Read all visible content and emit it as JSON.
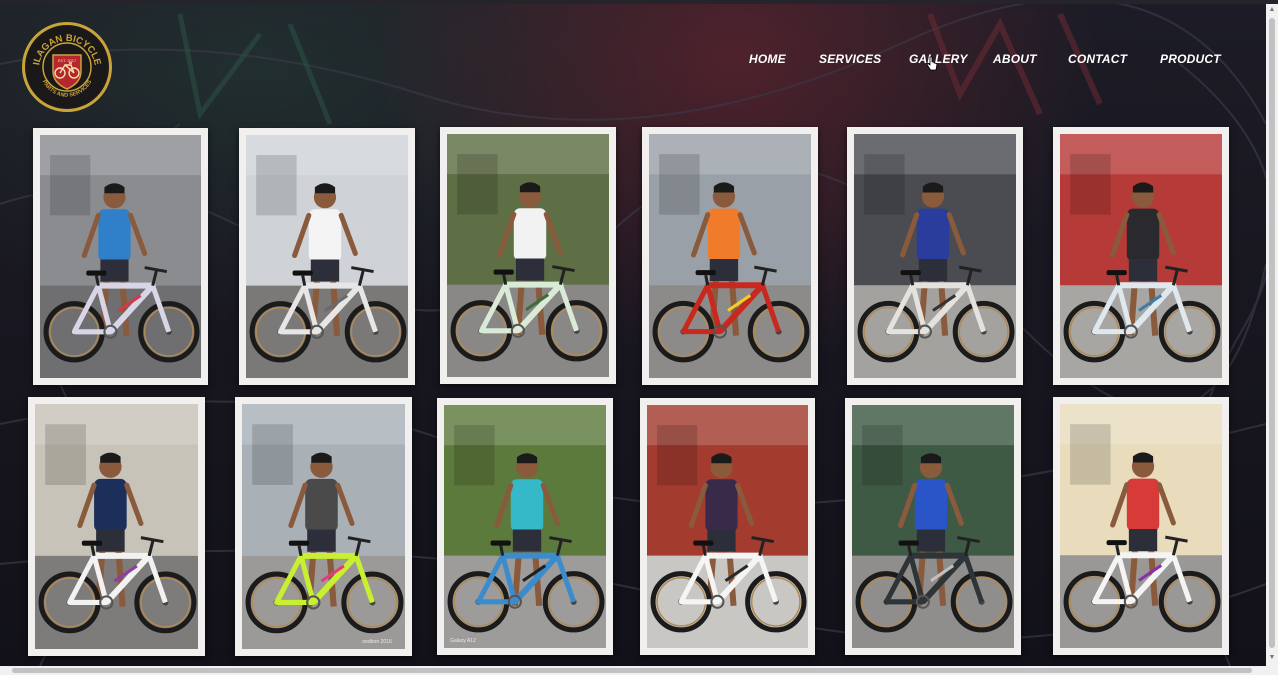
{
  "brand": {
    "name_top": "ILAGAN BICYCLE",
    "est": "EST. 2017",
    "tagline": "PARTS AND SERVICES",
    "colors": {
      "gold": "#c9a43a",
      "red": "#b5262f"
    }
  },
  "nav": {
    "items": [
      {
        "label": "HOME"
      },
      {
        "label": "SERVICES"
      },
      {
        "label": "GALLERY"
      },
      {
        "label": "ABOUT"
      },
      {
        "label": "CONTACT"
      },
      {
        "label": "PRODUCT"
      }
    ]
  },
  "gallery": {
    "photos": [
      {
        "shirt": "#2f7fc9",
        "frame": "#d8d6e6",
        "accent": "#d23a4a",
        "wall": "#8a8c90",
        "ground": "#6f6f72"
      },
      {
        "shirt": "#f4f4f4",
        "frame": "#e6e6e6",
        "accent": "#6a6a6a",
        "wall": "#cfd3d8",
        "ground": "#7a7978"
      },
      {
        "shirt": "#f2f2f2",
        "frame": "#d9ead7",
        "accent": "#3c6e3a",
        "wall": "#5e6e45",
        "ground": "#8a8886"
      },
      {
        "shirt": "#f07b2a",
        "frame": "#c8281e",
        "accent": "#f0d020",
        "wall": "#9aa0a8",
        "ground": "#8c8b8a"
      },
      {
        "shirt": "#2b3d9c",
        "frame": "#e4e2de",
        "accent": "#333333",
        "wall": "#4a4c52",
        "ground": "#a3a29f"
      },
      {
        "shirt": "#2a2a2e",
        "frame": "#dfe8ee",
        "accent": "#3b7fa8",
        "wall": "#b53a38",
        "ground": "#a8a6a3"
      },
      {
        "shirt": "#1c2f5a",
        "frame": "#f2f2f2",
        "accent": "#8b3fa0",
        "wall": "#c7c3b8",
        "ground": "#7d7c7b"
      },
      {
        "shirt": "#4a4a4a",
        "frame": "#c8f030",
        "accent": "#e63a7a",
        "wall": "#a9b1b7",
        "ground": "#9b9a99"
      },
      {
        "shirt": "#35b8c8",
        "frame": "#3a8ccc",
        "accent": "#1e1e1e",
        "wall": "#5d7a3d",
        "ground": "#9d9c9a"
      },
      {
        "shirt": "#3a2a4a",
        "frame": "#f5f5f5",
        "accent": "#2a2a2a",
        "wall": "#a33b2e",
        "ground": "#c9c7c4"
      },
      {
        "shirt": "#2a55c8",
        "frame": "#2e3438",
        "accent": "#c0c0c0",
        "wall": "#3e5a44",
        "ground": "#8f8e8c"
      },
      {
        "shirt": "#d83a38",
        "frame": "#f4f4f4",
        "accent": "#8a2fa8",
        "wall": "#e8dcbd",
        "ground": "#9a9896"
      }
    ],
    "watermarks": {
      "photo8": "oodbon 2016",
      "photo9": "Galaxy A12"
    }
  }
}
